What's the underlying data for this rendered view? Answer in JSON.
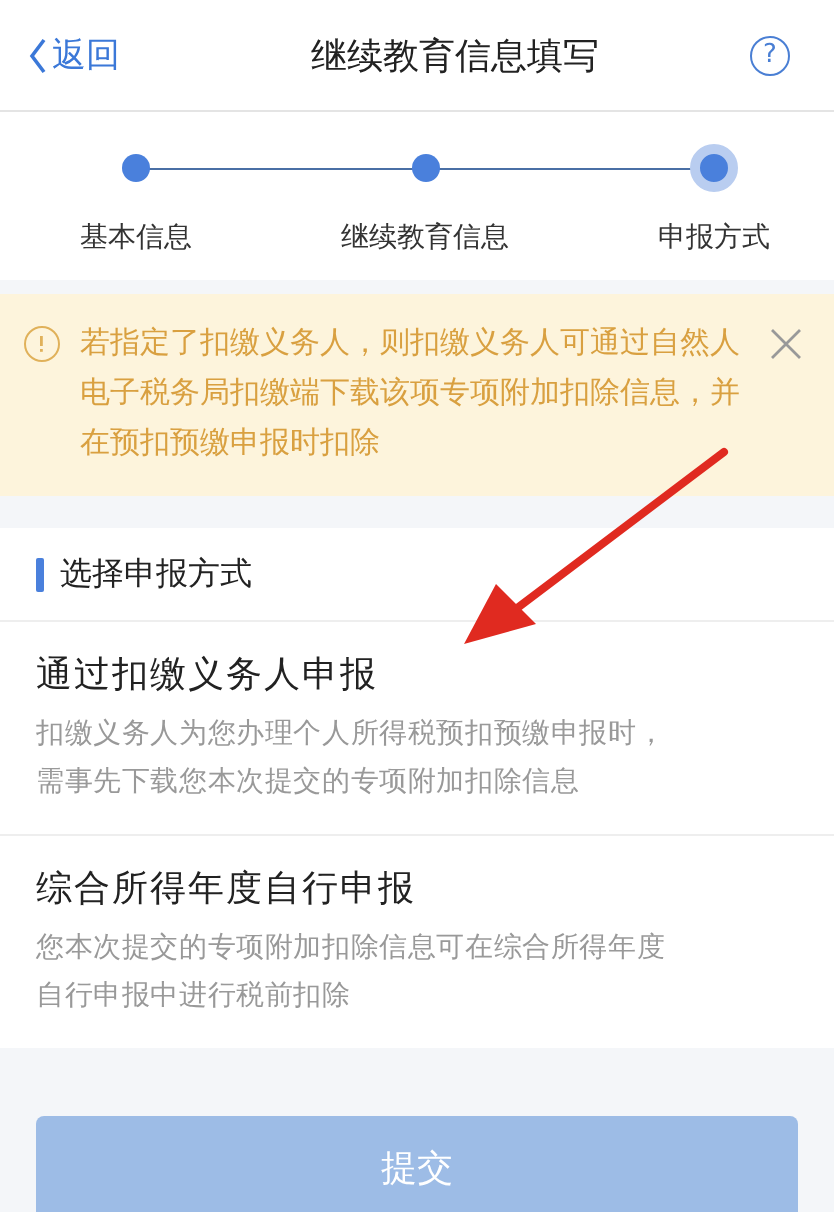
{
  "header": {
    "back": "返回",
    "title": "继续教育信息填写",
    "help": "?"
  },
  "steps": [
    {
      "label": "基本信息",
      "current": false
    },
    {
      "label": "继续教育信息",
      "current": false
    },
    {
      "label": "申报方式",
      "current": true
    }
  ],
  "notice": {
    "text": "若指定了扣缴义务人，则扣缴义务人可通过自然人电子税务局扣缴端下载该项专项附加扣除信息，并在预扣预缴申报时扣除"
  },
  "section_title": "选择申报方式",
  "options": [
    {
      "title": "通过扣缴义务人申报",
      "description": "扣缴义务人为您办理个人所得税预扣预缴申报时，需事先下载您本次提交的专项附加扣除信息"
    },
    {
      "title": "综合所得年度自行申报",
      "description": "您本次提交的专项附加扣除信息可在综合所得年度自行申报中进行税前扣除"
    }
  ],
  "submit": {
    "label": "提交",
    "disabled": true
  }
}
